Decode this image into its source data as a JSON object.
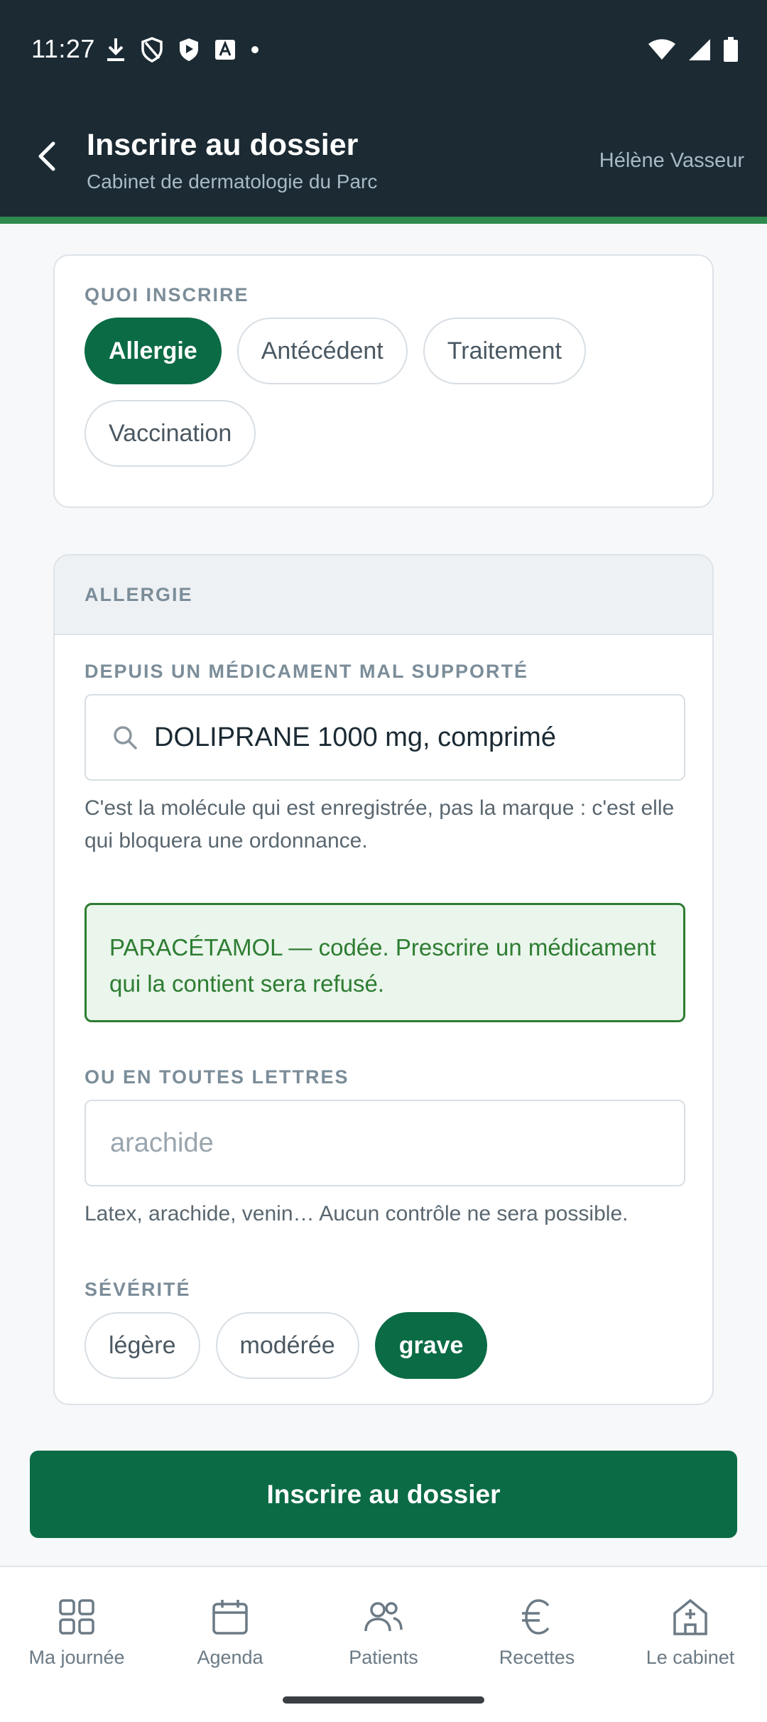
{
  "status_bar": {
    "time": "11:27",
    "left_icons": [
      "download-icon",
      "shield-outline-icon",
      "shield-play-icon",
      "text-a-icon",
      "dot-icon"
    ],
    "right_icons": [
      "wifi-icon",
      "signal-icon",
      "battery-icon"
    ]
  },
  "app_bar": {
    "title": "Inscrire au dossier",
    "subtitle": "Cabinet de dermatologie du Parc",
    "user": "Hélène Vasseur",
    "back_icon": "chevron-left-icon"
  },
  "what_card": {
    "label": "QUOI INSCRIRE",
    "chips": [
      {
        "label": "Allergie",
        "selected": true
      },
      {
        "label": "Antécédent",
        "selected": false
      },
      {
        "label": "Traitement",
        "selected": false
      },
      {
        "label": "Vaccination",
        "selected": false
      }
    ]
  },
  "allergy_card": {
    "header": "ALLERGIE",
    "drug_label": "DEPUIS UN MÉDICAMENT MAL SUPPORTÉ",
    "drug_value": "DOLIPRANE 1000 mg, comprimé",
    "drug_help": "C'est la molécule qui est enregistrée, pas la marque : c'est elle qui bloquera une ordonnance.",
    "notice": "PARACÉTAMOL — codée. Prescrire un médicament qui la contient sera refusé.",
    "free_label": "OU EN TOUTES LETTRES",
    "free_placeholder": "arachide",
    "free_help": "Latex, arachide, venin… Aucun contrôle ne sera possible.",
    "severity_label": "SÉVÉRITÉ",
    "severity_options": [
      {
        "label": "légère",
        "selected": false
      },
      {
        "label": "modérée",
        "selected": false
      },
      {
        "label": "grave",
        "selected": true
      }
    ]
  },
  "submit_label": "Inscrire au dossier",
  "bottom_nav": [
    {
      "label": "Ma journée",
      "icon": "grid-icon"
    },
    {
      "label": "Agenda",
      "icon": "calendar-icon"
    },
    {
      "label": "Patients",
      "icon": "people-icon"
    },
    {
      "label": "Recettes",
      "icon": "euro-icon"
    },
    {
      "label": "Le cabinet",
      "icon": "clinic-icon"
    }
  ],
  "colors": {
    "header_bg": "#1b2a33",
    "accent_green": "#0b6b45",
    "stripe_green": "#2f8a4f",
    "notice_green": "#2e7d32"
  }
}
